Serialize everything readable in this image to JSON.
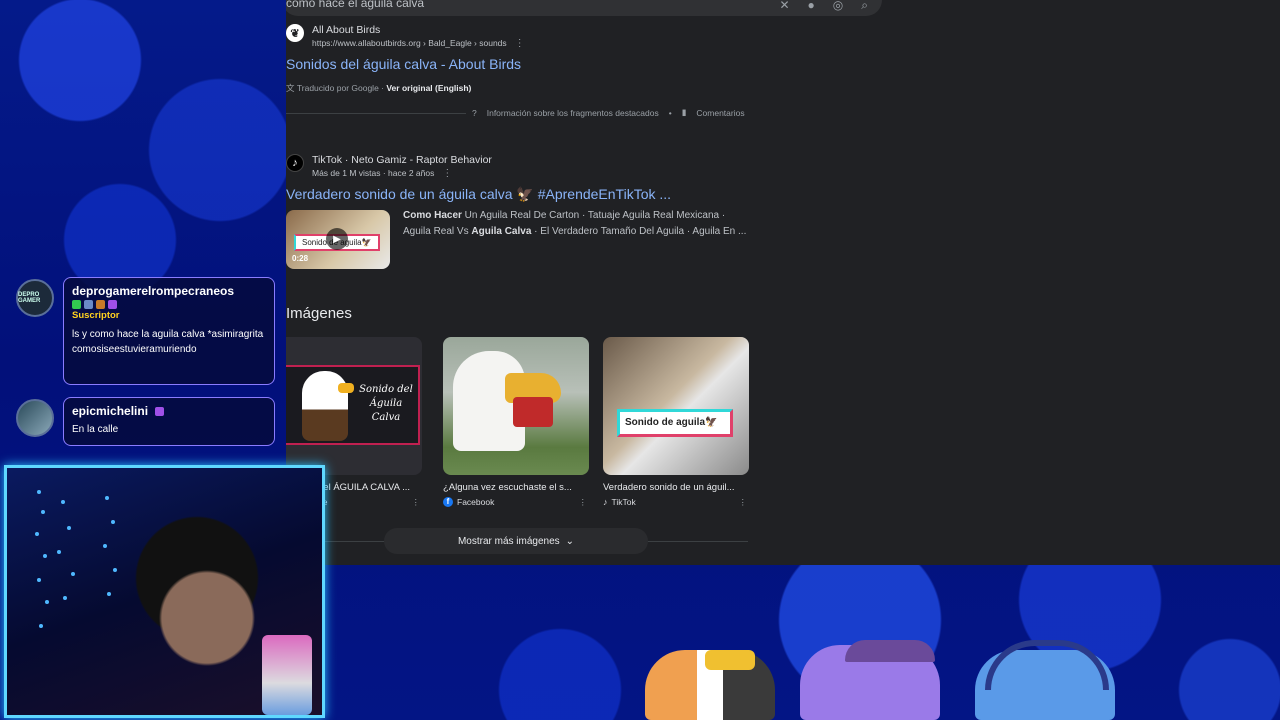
{
  "search": {
    "query": "como hace el aguila calva",
    "icons": [
      "close-icon",
      "mic-icon",
      "lens-icon",
      "search-icon"
    ]
  },
  "result1": {
    "site_name": "All About Birds",
    "site_url": "https://www.allaboutbirds.org › Bald_Eagle › sounds",
    "title": "Sonidos del águila calva - About Birds",
    "translated_by": "Traducido por Google ·",
    "view_original": "Ver original (English)"
  },
  "featured": {
    "about_label": "Información sobre los fragmentos destacados",
    "separator": "•",
    "feedback_label": "Comentarios"
  },
  "result2": {
    "site_name": "TikTok · Neto Gamiz - Raptor Behavior",
    "site_meta": "Más de 1 M vistas · hace 2 años",
    "title": "Verdadero sonido de un águila calva 🦅 #AprendeEnTikTok ...",
    "thumb_label": "Sonido de aguila🦅",
    "duration": "0:28",
    "desc_bold1": "Como Hacer",
    "desc_1": " Un Aguila Real De Carton · Tatuaje Aguila Real Mexicana ·",
    "desc_2": "Aguila Real Vs ",
    "desc_bold2": "Aguila Calva",
    "desc_3": " · El Verdadero Tamaño Del Aguila · Aguila En ..."
  },
  "images": {
    "title": "Imágenes",
    "items": [
      {
        "caption": "del ÁGUILA CALVA ...",
        "source": "be",
        "overlay": "Sonido del Águila Calva"
      },
      {
        "caption": "¿Alguna vez escuchaste el s...",
        "source": "Facebook",
        "overlay": ""
      },
      {
        "caption": "Verdadero sonido de un águil...",
        "source": "TikTok",
        "overlay": "Sonido de aguila🦅"
      }
    ],
    "more_button": "Mostrar más imágenes"
  },
  "chat": [
    {
      "user": "deprogamerelrompecraneos",
      "avatar_text": "DEPRO GAMER",
      "role": "Suscriptor",
      "text": "ls y como hace la aguila calva *asimiragritacomosiseestuvieramuriendo"
    },
    {
      "user": "epicmichelini",
      "avatar_text": "",
      "role": "",
      "text": "En la calle"
    }
  ],
  "colors": {
    "link": "#8ab4f8",
    "chat_border": "#8a7cff",
    "role": "#ffd21f",
    "webcam_border": "#5fd8ff"
  }
}
